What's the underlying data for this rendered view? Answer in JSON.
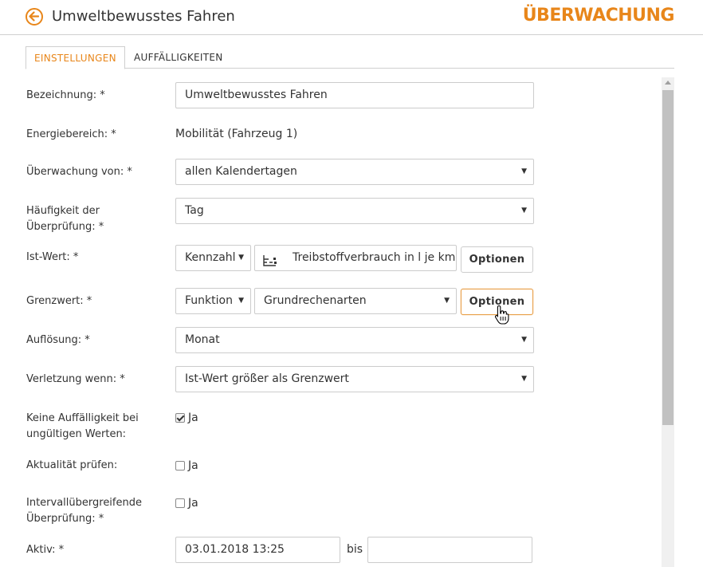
{
  "header": {
    "title": "Umweltbewusstes Fahren",
    "brand": "ÜBERWACHUNG",
    "accent_color": "#e8861a",
    "back_icon": "arrow-left-circle-icon"
  },
  "tabs": [
    {
      "label": "EINSTELLUNGEN",
      "active": true
    },
    {
      "label": "AUFFÄLLIGKEITEN",
      "active": false
    }
  ],
  "form": {
    "bezeichnung": {
      "label": "Bezeichnung: *",
      "value": "Umweltbewusstes Fahren"
    },
    "energiebereich": {
      "label": "Energiebereich: *",
      "value": "Mobilität (Fahrzeug 1)"
    },
    "ueberwachung_von": {
      "label": "Überwachung von: *",
      "value": "allen Kalendertagen"
    },
    "haeufigkeit": {
      "label_line1": "Häufigkeit der",
      "label_line2": "Überprüfung: *",
      "value": "Tag"
    },
    "ist_wert": {
      "label": "Ist-Wert: *",
      "type_value": "Kennzahl",
      "metric_icon": "hierarchy-icon",
      "metric_value": "Treibstoffverbrauch in l je km",
      "options_label": "Optionen"
    },
    "grenzwert": {
      "label": "Grenzwert: *",
      "type_value": "Funktion",
      "function_value": "Grundrechenarten",
      "options_label": "Optionen"
    },
    "aufloesung": {
      "label": "Auflösung: *",
      "value": "Monat"
    },
    "verletzung": {
      "label": "Verletzung wenn: *",
      "value": "Ist-Wert größer als Grenzwert"
    },
    "keine_auffaelligkeit": {
      "label_line1": "Keine Auffälligkeit bei",
      "label_line2": "ungültigen Werten:",
      "checkbox_label": "Ja",
      "checked": true
    },
    "aktualitaet": {
      "label": "Aktualität prüfen:",
      "checkbox_label": "Ja",
      "checked": false
    },
    "intervall": {
      "label_line1": "Intervallübergreifende",
      "label_line2": "Überprüfung: *",
      "checkbox_label": "Ja",
      "checked": false
    },
    "aktiv": {
      "label": "Aktiv: *",
      "from_value": "03.01.2018 13:25",
      "separator": "bis",
      "to_value": ""
    }
  }
}
